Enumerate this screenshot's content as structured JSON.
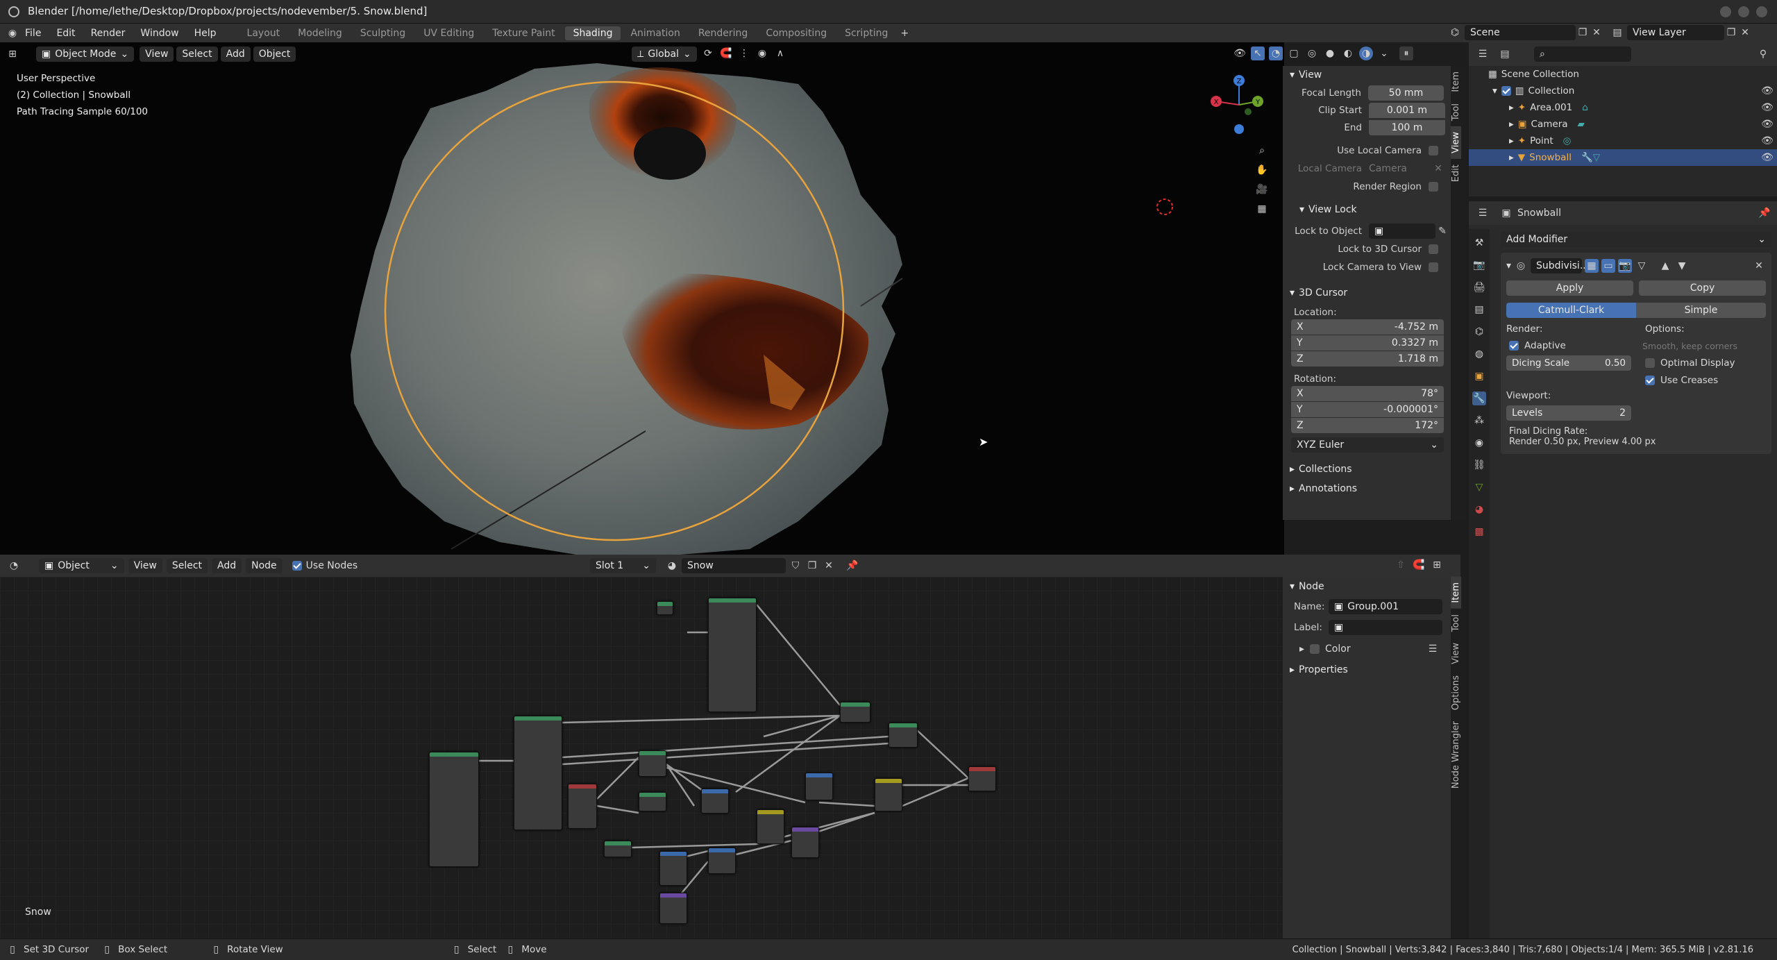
{
  "window": {
    "title": "Blender [/home/lethe/Desktop/Dropbox/projects/nodevember/5. Snow.blend]"
  },
  "menu": [
    "File",
    "Edit",
    "Render",
    "Window",
    "Help"
  ],
  "workspaces": [
    {
      "label": "Layout",
      "active": false
    },
    {
      "label": "Modeling",
      "active": false
    },
    {
      "label": "Sculpting",
      "active": false
    },
    {
      "label": "UV Editing",
      "active": false
    },
    {
      "label": "Texture Paint",
      "active": false
    },
    {
      "label": "Shading",
      "active": true
    },
    {
      "label": "Animation",
      "active": false
    },
    {
      "label": "Rendering",
      "active": false
    },
    {
      "label": "Compositing",
      "active": false
    },
    {
      "label": "Scripting",
      "active": false
    }
  ],
  "scene": {
    "name": "Scene",
    "view_layer": "View Layer"
  },
  "viewport": {
    "mode": "Object Mode",
    "menus": [
      "View",
      "Select",
      "Add",
      "Object"
    ],
    "orientation": "Global",
    "info": [
      "User Perspective",
      "(2) Collection | Snowball",
      "Path Tracing Sample 60/100"
    ],
    "gizmo_axes": [
      "X",
      "Y",
      "Z"
    ]
  },
  "view_panel": {
    "tabs": [
      "Item",
      "Tool",
      "View",
      "Edit"
    ],
    "view_title": "View",
    "focal_length_label": "Focal Length",
    "focal_length": "50 mm",
    "clip_start_label": "Clip Start",
    "clip_start": "0.001 m",
    "end_label": "End",
    "end": "100 m",
    "use_local_camera": "Use Local Camera",
    "local_camera_label": "Local Camera",
    "local_camera": "Camera",
    "render_region": "Render Region",
    "view_lock": "View Lock",
    "lock_to_object": "Lock to Object",
    "lock_to_cursor": "Lock to 3D Cursor",
    "lock_camera": "Lock Camera to View",
    "cursor_title": "3D Cursor",
    "location_label": "Location:",
    "loc": [
      {
        "axis": "X",
        "value": "-4.752 m"
      },
      {
        "axis": "Y",
        "value": "0.3327 m"
      },
      {
        "axis": "Z",
        "value": "1.718 m"
      }
    ],
    "rotation_label": "Rotation:",
    "rot": [
      {
        "axis": "X",
        "value": "78°"
      },
      {
        "axis": "Y",
        "value": "-0.000001°"
      },
      {
        "axis": "Z",
        "value": "172°"
      }
    ],
    "rot_mode": "XYZ Euler",
    "collections": "Collections",
    "annotations": "Annotations"
  },
  "outliner": {
    "root": "Scene Collection",
    "items": [
      {
        "label": "Collection",
        "depth": 1,
        "selected": false
      },
      {
        "label": "Area.001",
        "depth": 2,
        "selected": false
      },
      {
        "label": "Camera",
        "depth": 2,
        "selected": false
      },
      {
        "label": "Point",
        "depth": 2,
        "selected": false
      },
      {
        "label": "Snowball",
        "depth": 2,
        "selected": true
      }
    ]
  },
  "properties": {
    "object": "Snowball",
    "add_modifier": "Add Modifier",
    "modifier_name": "Subdivisi..",
    "apply": "Apply",
    "copy": "Copy",
    "catmull": "Catmull-Clark",
    "simple": "Simple",
    "render_label": "Render:",
    "options_label": "Options:",
    "adaptive": "Adaptive",
    "smooth": "Smooth, keep corners",
    "dicing_label": "Dicing Scale",
    "dicing_value": "0.50",
    "optimal_display": "Optimal Display",
    "use_creases": "Use Creases",
    "viewport_label": "Viewport:",
    "levels_label": "Levels",
    "levels_value": "2",
    "final_dicing": "Final Dicing Rate:",
    "final_dicing_value": "Render 0.50 px, Preview 4.00 px"
  },
  "node_editor": {
    "type": "Object",
    "menus": [
      "View",
      "Select",
      "Add",
      "Node"
    ],
    "use_nodes": "Use Nodes",
    "slot": "Slot 1",
    "material": "Snow",
    "footer_label": "Snow",
    "tabs": [
      "Item",
      "Tool",
      "View",
      "Options",
      "Node Wrangler"
    ],
    "node_title": "Node",
    "name_label": "Name:",
    "name_value": "Group.001",
    "label_label": "Label:",
    "color": "Color",
    "properties": "Properties"
  },
  "status": {
    "items": [
      "Set 3D Cursor",
      "Box Select",
      "Rotate View",
      "Select",
      "Move"
    ],
    "info": "Collection | Snowball | Verts:3,842 | Faces:3,840 | Tris:7,680 | Objects:1/4 | Mem: 365.5 MiB | v2.81.16"
  },
  "colors": {
    "accent": "#4772b3",
    "selection": "#334d80",
    "orange": "#e8a33c"
  }
}
